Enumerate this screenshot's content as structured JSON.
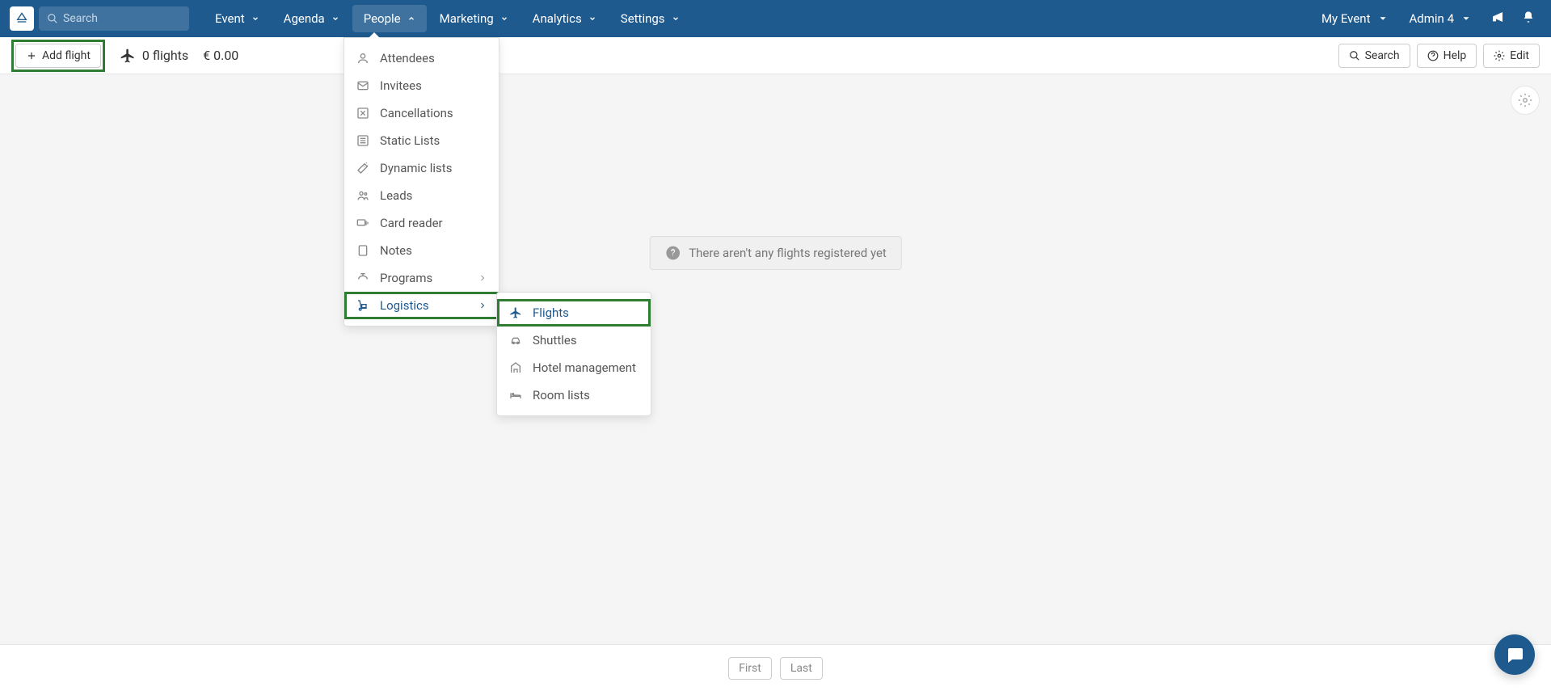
{
  "topnav": {
    "search_placeholder": "Search",
    "items": [
      {
        "label": "Event"
      },
      {
        "label": "Agenda"
      },
      {
        "label": "People"
      },
      {
        "label": "Marketing"
      },
      {
        "label": "Analytics"
      },
      {
        "label": "Settings"
      }
    ],
    "right": {
      "event_label": "My Event",
      "admin_label": "Admin 4"
    }
  },
  "toolbar": {
    "add_flight": "Add flight",
    "flights_count": "0 flights",
    "cost": "€ 0.00",
    "search": "Search",
    "help": "Help",
    "edit": "Edit"
  },
  "dropdown": {
    "items": [
      {
        "label": "Attendees",
        "icon": "user"
      },
      {
        "label": "Invitees",
        "icon": "mail"
      },
      {
        "label": "Cancellations",
        "icon": "cancel"
      },
      {
        "label": "Static Lists",
        "icon": "list"
      },
      {
        "label": "Dynamic lists",
        "icon": "wand"
      },
      {
        "label": "Leads",
        "icon": "users"
      },
      {
        "label": "Card reader",
        "icon": "card"
      },
      {
        "label": "Notes",
        "icon": "note"
      },
      {
        "label": "Programs",
        "icon": "speaker"
      },
      {
        "label": "Logistics",
        "icon": "dolly"
      }
    ]
  },
  "submenu": {
    "items": [
      {
        "label": "Flights",
        "icon": "plane"
      },
      {
        "label": "Shuttles",
        "icon": "car"
      },
      {
        "label": "Hotel management",
        "icon": "hotel"
      },
      {
        "label": "Room lists",
        "icon": "bed"
      }
    ]
  },
  "content": {
    "empty_message": "There aren't any flights registered yet"
  },
  "footer": {
    "first": "First",
    "last": "Last"
  }
}
